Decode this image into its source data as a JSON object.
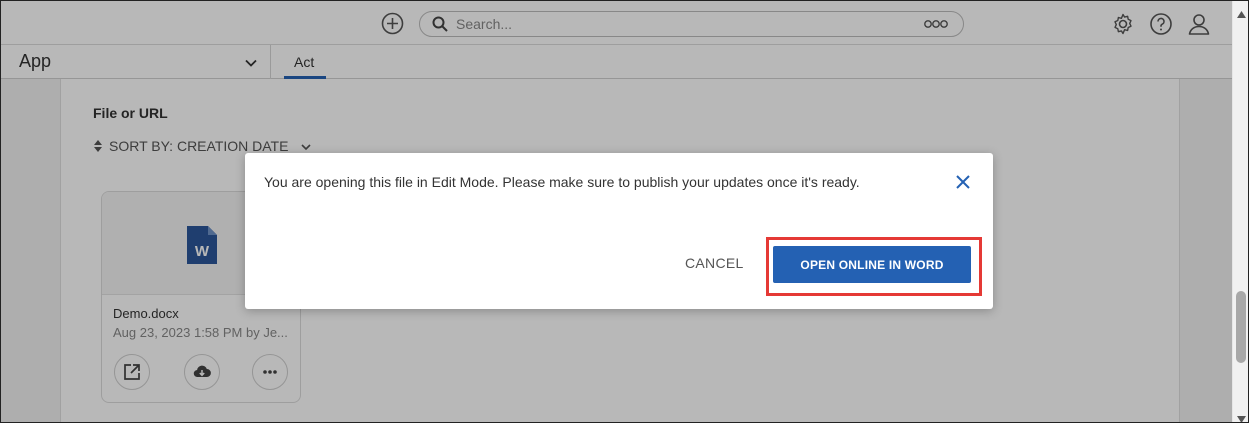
{
  "search": {
    "placeholder": "Search..."
  },
  "app_selector": {
    "label": "App"
  },
  "tabs": [
    {
      "label": "Act"
    }
  ],
  "section": {
    "title": "File or URL",
    "sort_label": "SORT BY: CREATION DATE"
  },
  "file_card": {
    "name": "Demo.docx",
    "meta": "Aug 23, 2023 1:58 PM by Je...",
    "icon_letter": "W"
  },
  "dialog": {
    "message": "You are opening this file in Edit Mode. Please make sure to publish your updates once it's ready.",
    "cancel_label": "CANCEL",
    "confirm_label": "OPEN ONLINE IN WORD"
  },
  "colors": {
    "primary": "#2461b3",
    "highlight": "#e53935",
    "word_blue": "#2b579a"
  },
  "icons": [
    "add-icon",
    "search-icon",
    "more-icon",
    "gear-icon",
    "help-icon",
    "user-icon",
    "chevron-down-icon",
    "sort-icon",
    "word-doc-icon",
    "open-external-icon",
    "download-icon",
    "ellipsis-icon",
    "close-icon"
  ]
}
